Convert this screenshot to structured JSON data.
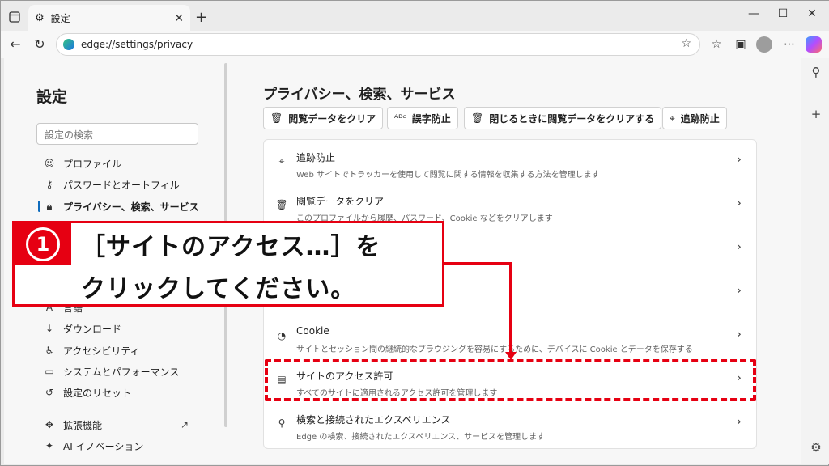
{
  "browser": {
    "tab_title": "設定",
    "close_glyph": "✕",
    "new_tab_glyph": "+",
    "url": "edge://settings/privacy",
    "window_controls": {
      "minimize": "—",
      "maximize": "☐",
      "close": "✕"
    }
  },
  "sidebar": {
    "title": "設定",
    "search_placeholder": "設定の検索",
    "items": [
      {
        "label": "プロファイル",
        "icon": "profile-icon"
      },
      {
        "label": "パスワードとオートフィル",
        "icon": "key-icon"
      },
      {
        "label": "プライバシー、検索、サービス",
        "icon": "lock-icon",
        "active": true
      },
      {
        "label": "言語",
        "icon": "language-icon"
      },
      {
        "label": "ダウンロード",
        "icon": "download-icon"
      },
      {
        "label": "アクセシビリティ",
        "icon": "accessibility-icon"
      },
      {
        "label": "システムとパフォーマンス",
        "icon": "laptop-icon"
      },
      {
        "label": "設定のリセット",
        "icon": "reset-icon"
      },
      {
        "label": "拡張機能",
        "icon": "extensions-icon"
      },
      {
        "label": "AI イノベーション",
        "icon": "ai-icon"
      }
    ]
  },
  "main": {
    "title": "プライバシー、検索、サービス",
    "quick_buttons": [
      {
        "label": "閲覧データをクリア",
        "icon": "trash-icon"
      },
      {
        "label": "誤字防止",
        "icon": "spellcheck-icon"
      },
      {
        "label": "閉じるときに閲覧データをクリアする",
        "icon": "trash-clock-icon"
      },
      {
        "label": "追跡防止",
        "icon": "tracking-icon"
      }
    ],
    "rows": [
      {
        "title": "追跡防止",
        "desc": "Web サイトでトラッカーを使用して閲覧に関する情報を収集する方法を管理します",
        "icon": "tracking-icon"
      },
      {
        "title": "閲覧データをクリア",
        "desc": "このプロファイルから履歴、パスワード、Cookie などをクリアします",
        "icon": "trash-icon"
      },
      {
        "title": "",
        "desc": "",
        "icon": ""
      },
      {
        "title": "",
        "desc": "",
        "icon": ""
      },
      {
        "title": "Cookie",
        "desc": "サイトとセッション間の継続的なブラウジングを容易にするために、デバイスに Cookie とデータを保存する",
        "icon": "cookie-icon"
      },
      {
        "title": "サイトのアクセス許可",
        "desc": "すべてのサイトに適用されるアクセス許可を管理します",
        "icon": "site-permissions-icon"
      },
      {
        "title": "検索と接続されたエクスペリエンス",
        "desc": "Edge の検索、接続されたエクスペリエンス、サービスを管理します",
        "icon": "search-icon"
      }
    ]
  },
  "annotation": {
    "step": "1",
    "line1": "［サイトのアクセス…］を",
    "line2": "クリックしてください。",
    "color": "#e60012"
  }
}
